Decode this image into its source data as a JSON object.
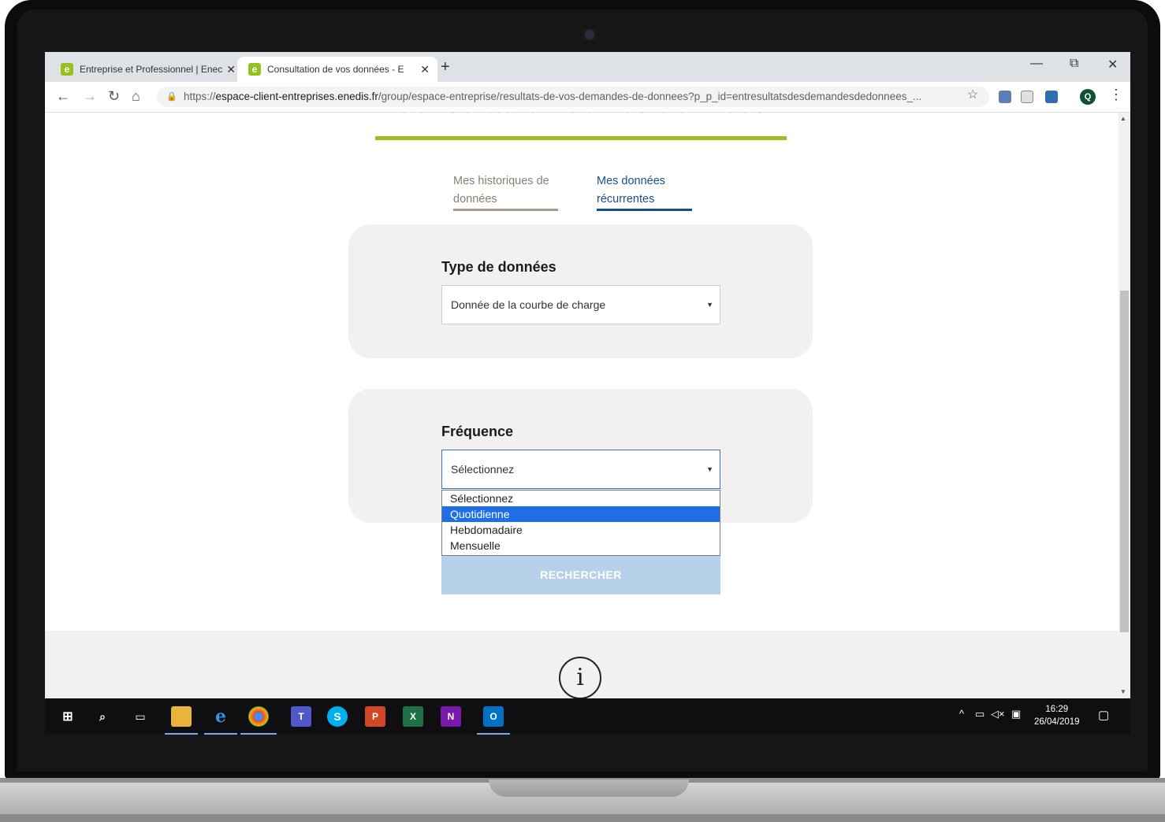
{
  "browser": {
    "tabs": [
      {
        "label": "Entreprise et Professionnel | Enec",
        "active": false
      },
      {
        "label": "Consultation de vos données - E",
        "active": true
      }
    ],
    "url_prefix": "https://",
    "url_host": "espace-client-entreprises.enedis.fr",
    "url_path": "/group/espace-entreprise/resultats-de-vos-demandes-de-donnees?p_p_id=entresultatsdesdemandesdedonnees_...",
    "profile_initial": "Q"
  },
  "page": {
    "heading": "Consultation de vos données",
    "subtabs": [
      {
        "label": "Mes historiques de données",
        "active": false
      },
      {
        "label": "Mes données récurrentes",
        "active": true
      }
    ],
    "type_label": "Type de données",
    "type_value": "Donnée de la courbe de charge",
    "freq_label": "Fréquence",
    "freq_value": "Sélectionnez",
    "freq_options": [
      "Sélectionnez",
      "Quotidienne",
      "Hebdomadaire",
      "Mensuelle"
    ],
    "freq_highlighted": "Quotidienne",
    "search_button": "RECHERCHER"
  },
  "taskbar": {
    "time": "16:29",
    "date": "26/04/2019"
  },
  "colors": {
    "brand_green": "#96c11f",
    "brand_blue": "#1a4e8a",
    "highlight": "#1e6fe6"
  }
}
